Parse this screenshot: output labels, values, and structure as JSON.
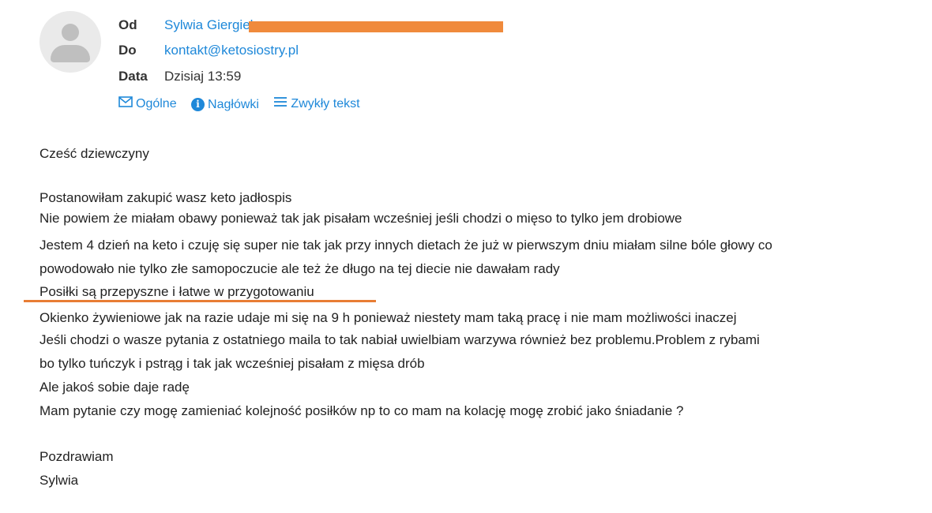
{
  "header": {
    "from_label": "Od",
    "from_name": "Sylwia Giergiel",
    "to_label": "Do",
    "to_email": "kontakt@ketosiostry.pl",
    "date_label": "Data",
    "date_value": "Dzisiaj 13:59"
  },
  "view_tabs": [
    {
      "label": "Ogólne",
      "icon": "envelope-icon"
    },
    {
      "label": "Nagłówki",
      "icon": "info-icon"
    },
    {
      "label": "Zwykły tekst",
      "icon": "lines-icon"
    }
  ],
  "message": {
    "greeting": "Cześć dziewczyny",
    "lines": [
      "Postanowiłam zakupić wasz keto jadłospis",
      "Nie powiem że miałam obawy ponieważ tak jak pisałam wcześniej jeśli chodzi o mięso to tylko jem drobiowe",
      "Jestem 4 dzień na keto i czuję się super nie tak jak przy innych dietach że już w pierwszym dniu miałam silne bóle głowy co",
      "powodowało nie tylko złe samopoczucie ale też że długo na tej diecie nie dawałam rady",
      "Posiłki są przepyszne i łatwe w przygotowaniu",
      "Okienko żywieniowe jak na razie udaje mi się na 9 h ponieważ niestety mam taką pracę i nie mam możliwości inaczej",
      " Jeśli chodzi o wasze pytania z ostatniego maila to tak nabiał uwielbiam  warzywa również bez problemu.Problem z rybami",
      "bo tylko tuńczyk i pstrąg i tak jak wcześniej pisałam z mięsa drób",
      "Ale jakoś sobie daje radę",
      "Mam pytanie czy mogę zamieniać kolejność posiłków np to co mam na kolację mogę zrobić jako śniadanie ?"
    ],
    "closing": "Pozdrawiam",
    "signature": "Sylwia"
  },
  "colors": {
    "link": "#1e88d9",
    "highlight": "#e87d34"
  }
}
